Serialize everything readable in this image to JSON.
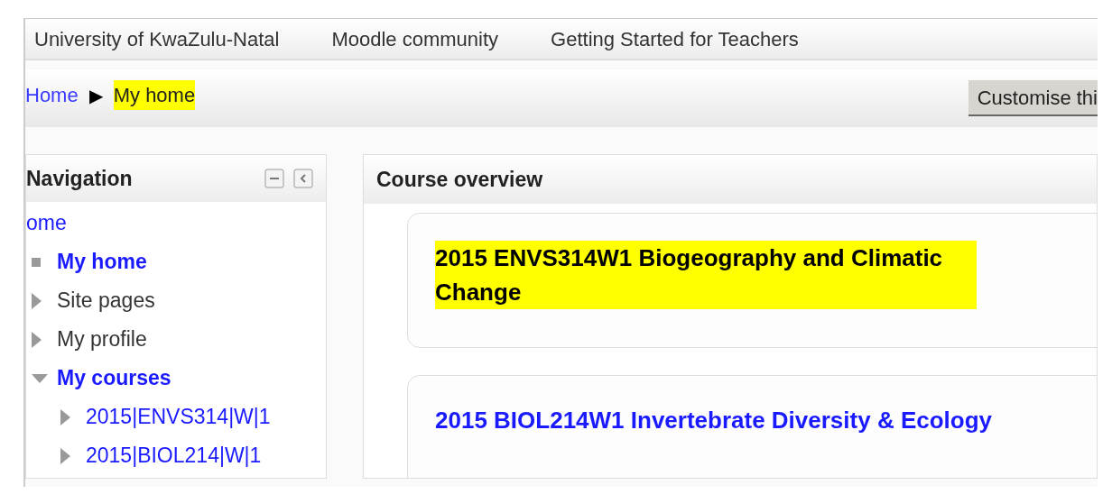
{
  "top_menu": [
    {
      "label": "University of KwaZulu-Natal"
    },
    {
      "label": "Moodle community"
    },
    {
      "label": "Getting Started for Teachers"
    }
  ],
  "breadcrumb": {
    "items": [
      {
        "label": "Home",
        "highlighted": false
      },
      {
        "label": "My home",
        "highlighted": true
      }
    ],
    "separator": "▶"
  },
  "customise_button": "Customise thi",
  "navigation": {
    "title": "Navigation",
    "items": [
      {
        "label": "ome",
        "kind": "link",
        "emphasized": false
      },
      {
        "label": "My home",
        "kind": "leaf",
        "emphasized": true
      },
      {
        "label": "Site pages",
        "kind": "branch",
        "expanded": false,
        "emphasized": false
      },
      {
        "label": "My profile",
        "kind": "branch",
        "expanded": false,
        "emphasized": false
      },
      {
        "label": "My courses",
        "kind": "branch",
        "expanded": true,
        "emphasized": true,
        "children": [
          {
            "label": "2015|ENVS314|W|1",
            "kind": "branch",
            "expanded": false,
            "emphasized": false
          },
          {
            "label": "2015|BIOL214|W|1",
            "kind": "branch",
            "expanded": false,
            "emphasized": false
          }
        ]
      }
    ]
  },
  "course_overview": {
    "title": "Course overview",
    "courses": [
      {
        "title": "2015 ENVS314W1 Biogeography and Climatic Change",
        "highlighted": true
      },
      {
        "title": "2015 BIOL214W1 Invertebrate Diversity & Ecology",
        "highlighted": false
      }
    ]
  }
}
